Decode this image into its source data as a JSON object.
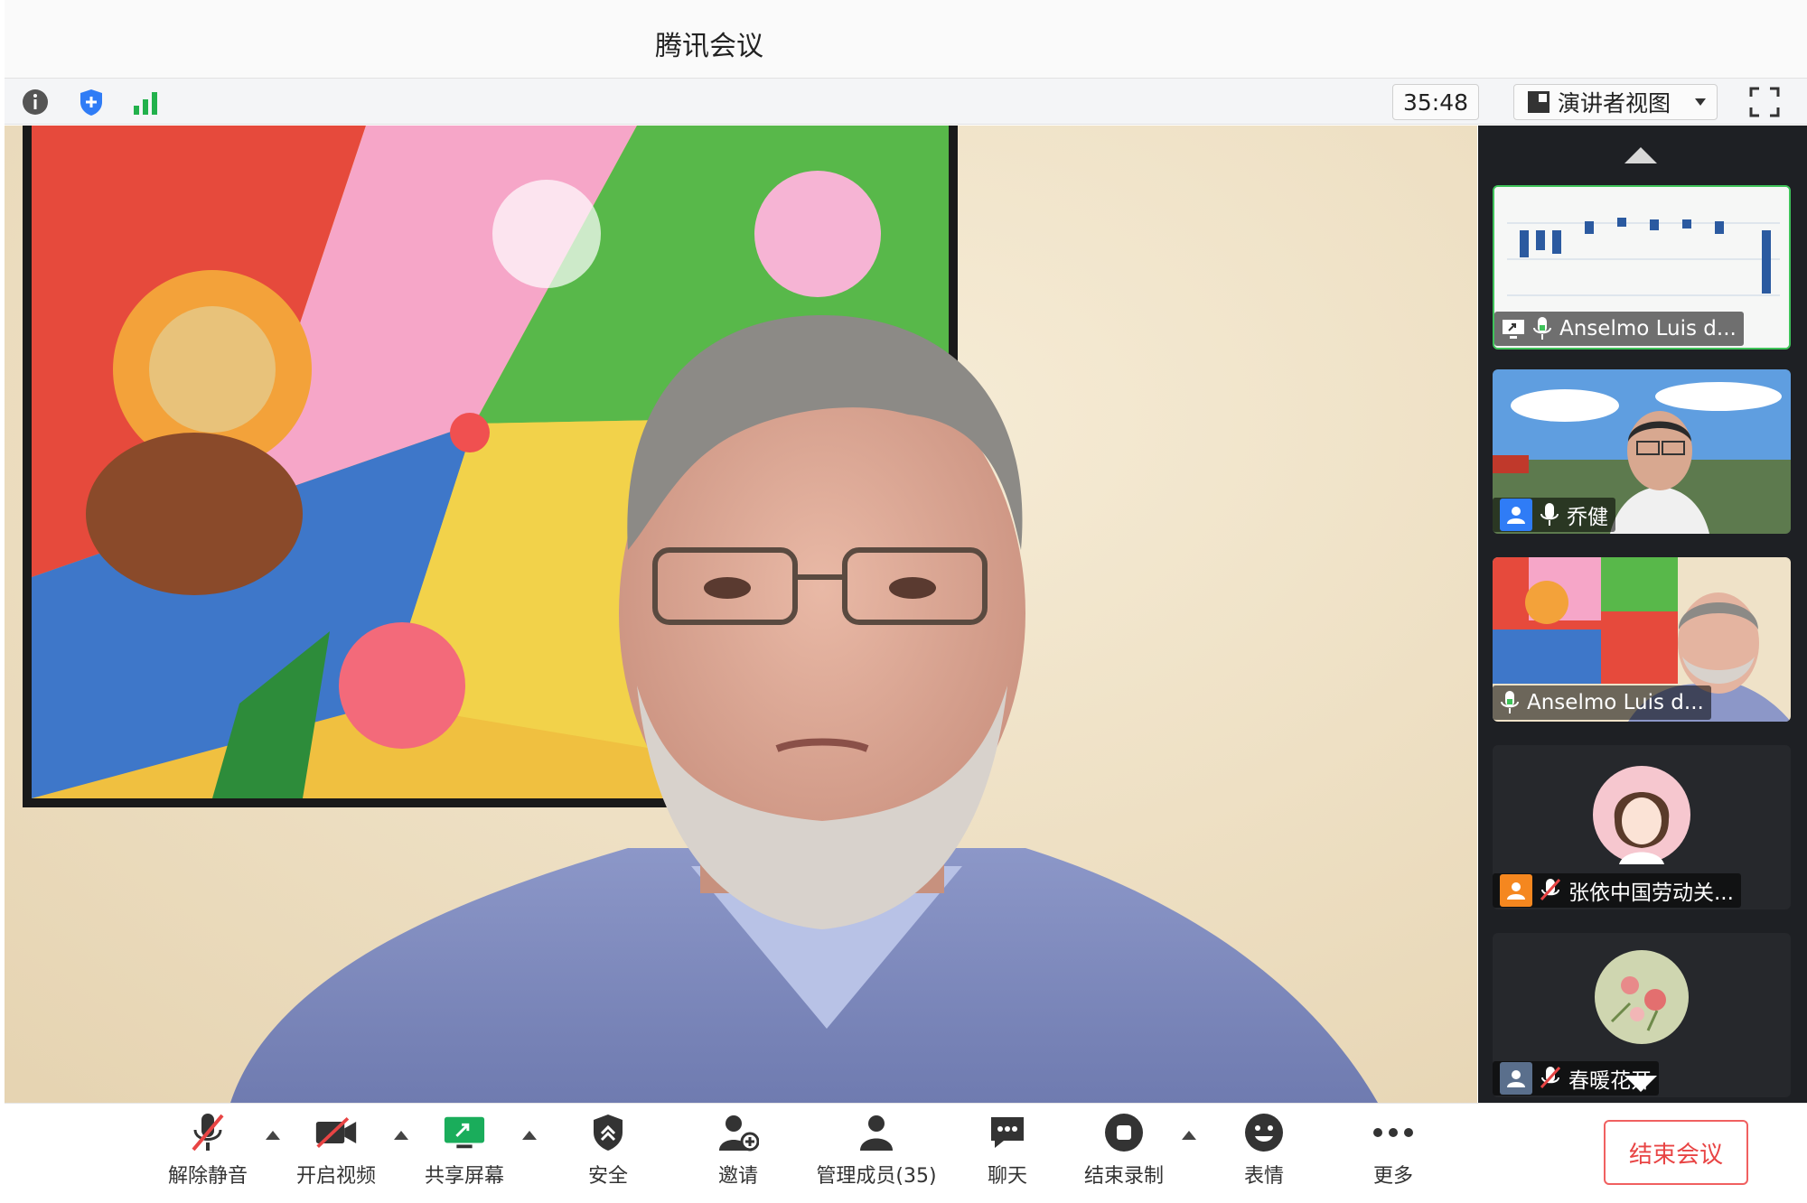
{
  "window": {
    "title": "腾讯会议"
  },
  "toolbar": {
    "timer": "35:48",
    "view_label": "演讲者视图",
    "icons": [
      "info-icon",
      "shield-icon",
      "signal-icon",
      "fullscreen-icon"
    ]
  },
  "participants": [
    {
      "name": "Anselmo Luis d...",
      "type": "screen-share",
      "mic": "on"
    },
    {
      "name": "乔健",
      "type": "video",
      "mic": "on"
    },
    {
      "name": "Anselmo Luis d...",
      "type": "video",
      "mic": "on"
    },
    {
      "name": "张依中国劳动关...",
      "type": "avatar",
      "mic": "muted"
    },
    {
      "name": "春暖花开",
      "type": "avatar",
      "mic": "muted"
    }
  ],
  "controls": {
    "unmute": "解除静音",
    "start_video": "开启视频",
    "share_screen": "共享屏幕",
    "security": "安全",
    "invite": "邀请",
    "manage_members": "管理成员(35)",
    "chat": "聊天",
    "end_recording": "结束录制",
    "reactions": "表情",
    "more": "更多",
    "end_meeting": "结束会议"
  },
  "colors": {
    "accent_blue": "#2f7cf6",
    "end_red": "#e84444",
    "share_green": "#1aad5b",
    "signal_green": "#22b14c",
    "sidebar_bg": "#1e2024"
  }
}
